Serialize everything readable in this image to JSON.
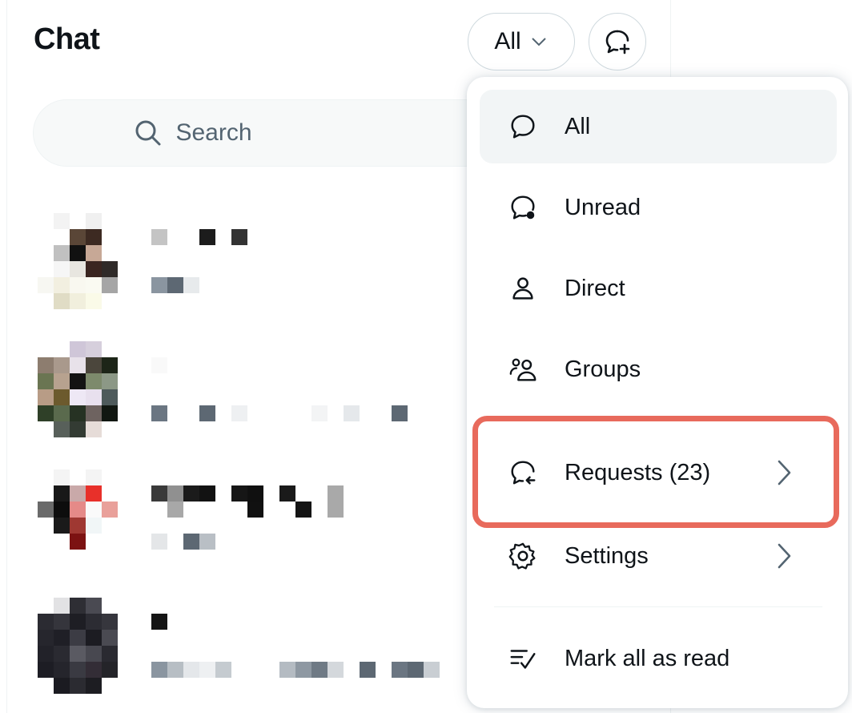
{
  "header": {
    "title": "Chat",
    "filter_label": "All"
  },
  "search": {
    "placeholder": "Search"
  },
  "menu": {
    "items": [
      {
        "label": "All",
        "icon": "chat-bubble-icon",
        "active": true
      },
      {
        "label": "Unread",
        "icon": "chat-bubble-unread-icon"
      },
      {
        "label": "Direct",
        "icon": "person-icon"
      },
      {
        "label": "Groups",
        "icon": "people-icon"
      },
      {
        "label": "Requests (23)",
        "icon": "chat-request-icon",
        "submenu": true
      },
      {
        "label": "Settings",
        "icon": "gear-icon",
        "submenu": true
      },
      {
        "label": "Mark all as read",
        "icon": "mark-read-icon"
      }
    ]
  },
  "highlight_color": "#e86a5c",
  "accent_color": "#0f1419"
}
